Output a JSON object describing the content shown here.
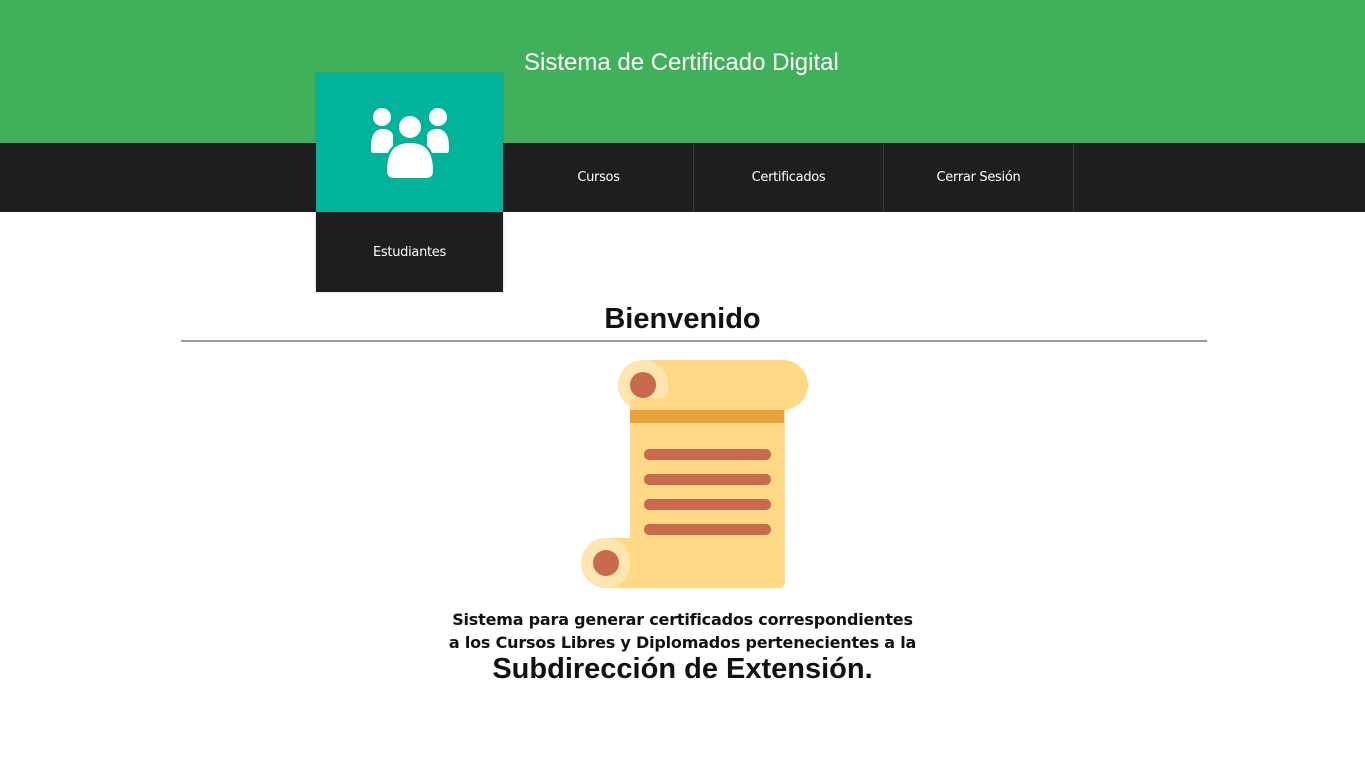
{
  "header": {
    "title": "Sistema de Certificado Digital",
    "bg_color": "#41b05a"
  },
  "nav": {
    "bg_color": "#1e1e1e",
    "items": [
      {
        "label": "Cursos"
      },
      {
        "label": "Certificados"
      },
      {
        "label": "Cerrar Sesión"
      }
    ]
  },
  "students_tile": {
    "label": "Estudiantes",
    "icon": "users-group-icon",
    "tile_color": "#00b39a"
  },
  "main": {
    "heading": "Bienvenido",
    "illustration": "scroll-certificate-icon",
    "description_line1": "Sistema para generar certificados correspondientes",
    "description_line2": "a los Cursos Libres y Diplomados pertenecientes a la",
    "department": "Subdirección de Extensión."
  }
}
